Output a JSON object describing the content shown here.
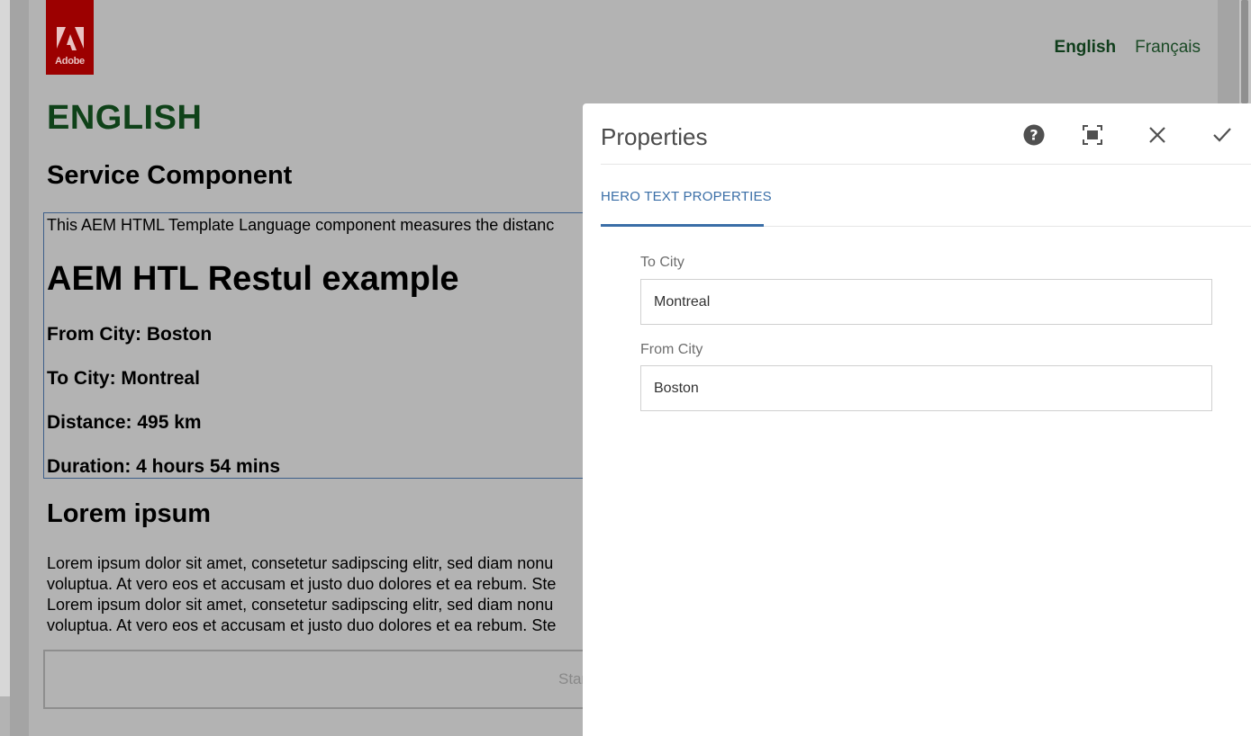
{
  "page": {
    "logo_text": "Adobe",
    "language_nav": [
      {
        "label": "English"
      },
      {
        "label": "Français"
      }
    ],
    "title": "ENGLISH",
    "section_heading": "Service Component",
    "component": {
      "intro": "This AEM HTML Template Language component measures the distanc",
      "heading": "AEM HTL Restul example",
      "from_city": "From City: Boston",
      "to_city": "To City: Montreal",
      "distance": "Distance: 495 km",
      "duration": "Duration: 4 hours 54 mins"
    },
    "lorem_heading": "Lorem ipsum",
    "lorem_lines": [
      "Lorem ipsum dolor sit amet, consetetur sadipscing elitr, sed diam nonu",
      "voluptua. At vero eos et accusam et justo duo dolores et ea rebum. Ste",
      "Lorem ipsum dolor sit amet, consetetur sadipscing elitr, sed diam nonu",
      "voluptua. At vero eos et accusam et justo duo dolores et ea rebum. Ste"
    ],
    "start_button_label": "Star"
  },
  "dialog": {
    "title": "Properties",
    "icons": [
      "help-icon",
      "fullscreen-icon",
      "close-icon",
      "checkmark-icon"
    ],
    "tab_label": "HERO TEXT PROPERTIES",
    "fields": [
      {
        "label": "To City",
        "value": "Montreal"
      },
      {
        "label": "From City",
        "value": "Boston"
      }
    ]
  },
  "colors": {
    "overlay_gray": "#b3b3b3",
    "heading_green": "#0f4219",
    "tab_blue": "#3a6ea7",
    "logo_red": "#9c0000"
  }
}
